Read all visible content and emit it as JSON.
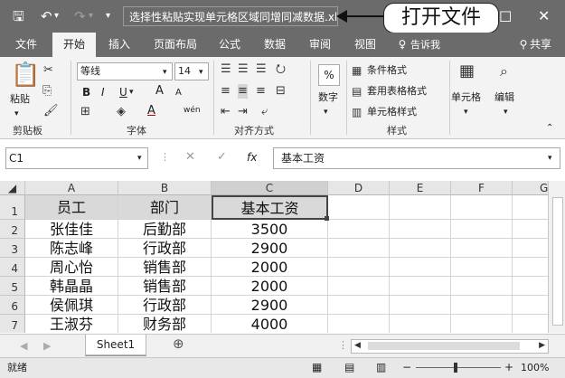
{
  "title_bar": {
    "save_icon": "save-icon",
    "undo_icon": "undo-icon",
    "redo_icon": "redo-icon",
    "customize_icon": "quick-access-dropdown-icon",
    "filename": "选择性粘贴实现单元格区域同增同减数据.xlsx",
    "callout_text": "打开文件"
  },
  "tabs": [
    "文件",
    "开始",
    "插入",
    "页面布局",
    "公式",
    "数据",
    "审阅",
    "视图",
    "告诉我",
    "共享"
  ],
  "active_tab": "开始",
  "ribbon": {
    "paste_label": "粘贴",
    "clipboard_group": "剪贴板",
    "font_name": "等线",
    "font_size": "14",
    "bold": "B",
    "italic": "I",
    "underline": "U",
    "increase_font": "A",
    "decrease_font": "A",
    "wen": "wén",
    "font_group": "字体",
    "align_group": "对齐方式",
    "number_label": "数字",
    "percent_symbol": "%",
    "cond_format": "条件格式",
    "table_format": "套用表格格式",
    "cell_style": "单元格样式",
    "styles_group": "样式",
    "cells_label": "单元格",
    "edit_label": "编辑"
  },
  "formula_bar": {
    "name_box": "C1",
    "fx": "fx",
    "formula": "基本工资"
  },
  "sheet": {
    "columns": [
      "A",
      "B",
      "C",
      "D",
      "E",
      "F",
      "G"
    ],
    "row_numbers": [
      "1",
      "2",
      "3",
      "4",
      "5",
      "6",
      "7"
    ],
    "rows": [
      [
        "员工",
        "部门",
        "基本工资"
      ],
      [
        "张佳佳",
        "后勤部",
        "3500"
      ],
      [
        "陈志峰",
        "行政部",
        "2900"
      ],
      [
        "周心怡",
        "销售部",
        "2000"
      ],
      [
        "韩晶晶",
        "销售部",
        "2000"
      ],
      [
        "侯佩琪",
        "行政部",
        "2900"
      ],
      [
        "王淑芬",
        "财务部",
        "4000"
      ]
    ],
    "selected_cell": "C1"
  },
  "sheet_tabs": {
    "active": "Sheet1",
    "add_icon": "add-sheet-icon"
  },
  "status_bar": {
    "mode": "就绪",
    "zoom": "100%",
    "minus": "−",
    "plus": "+"
  },
  "colors": {
    "title_bg": "#6b6b6b",
    "ribbon_bg": "#f3f3f3",
    "header_bg": "#d9d9d9",
    "selected_border": "#444444"
  }
}
